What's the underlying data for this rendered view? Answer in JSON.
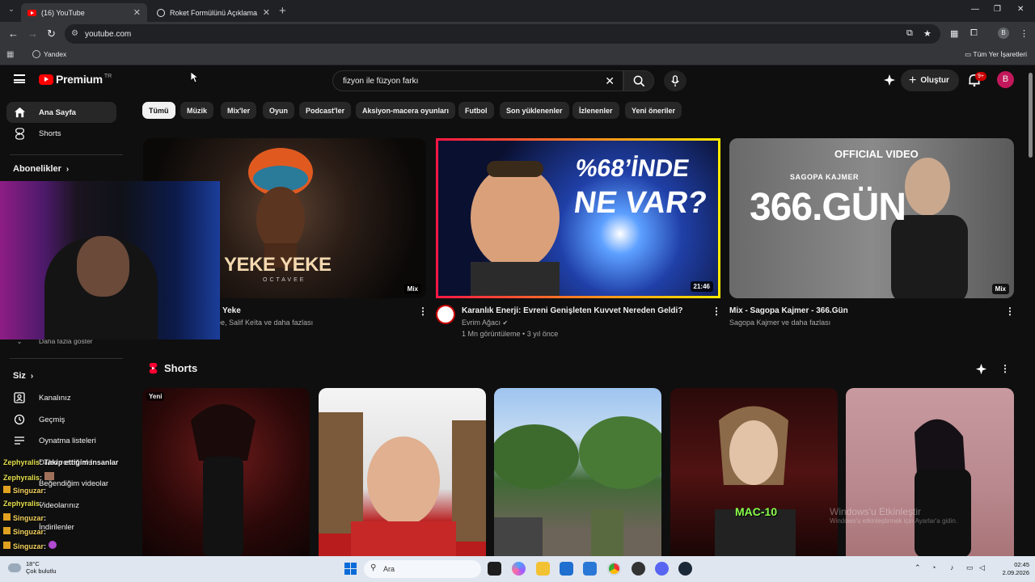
{
  "browser": {
    "tabs": [
      {
        "label": "(16) YouTube"
      },
      {
        "label": "Roket Formülünü Açıklama"
      }
    ],
    "url": "youtube.com",
    "bookmarks": {
      "yandex": "Yandex",
      "all": "Tüm Yer İşaretleri"
    },
    "profile_initial": "B"
  },
  "header": {
    "logo_text": "Premium",
    "logo_country": "TR",
    "search_value": "fizyon ile füzyon farkı",
    "create_label": "Oluştur",
    "notification_count": "9+",
    "avatar_initial": "B"
  },
  "sidebar": {
    "items": [
      {
        "label": "Ana Sayfa"
      },
      {
        "label": "Shorts"
      }
    ],
    "subscriptions_head": "Abonelikler",
    "show_more": "Daha fazla göster",
    "you_head": "Siz",
    "you_items": [
      {
        "label": "Kanalınız"
      },
      {
        "label": "Geçmiş"
      },
      {
        "label": "Oynatma listeleri"
      },
      {
        "label": "Daha sonra izle"
      },
      {
        "label": "Beğendiğim videolar"
      },
      {
        "label": "Videolarınız"
      },
      {
        "label": "İndirilenler"
      }
    ]
  },
  "chips": [
    "Tümü",
    "Müzik",
    "Mix'ler",
    "Oyun",
    "Podcast'ler",
    "Aksiyon-macera oyunları",
    "Futbol",
    "Son yüklenenler",
    "İzlenenler",
    "Yeni öneriler"
  ],
  "videos": [
    {
      "title": "Yeke",
      "meta1": "ee, Salif Keïta ve daha fazlası",
      "meta2": "",
      "badge": "Mix",
      "thumb_text": "YEKE YEKE",
      "thumb_sub": "OCTAVEE"
    },
    {
      "title": "Karanlık Enerji: Evreni Genişleten Kuvvet Nereden Geldi?",
      "meta1": "Evrim Ağacı",
      "meta2": "1 Mn görüntüleme • 3 yıl önce",
      "badge": "21:46",
      "thumb_text1": "%68’İNDE",
      "thumb_text2": "NE VAR?"
    },
    {
      "title": "Mix - Sagopa Kajmer - 366.Gün",
      "meta1": "Sagopa Kajmer ve daha fazlası",
      "meta2": "",
      "badge": "Mix",
      "thumb_top": "OFFICIAL VIDEO",
      "thumb_artist": "SAGOPA KAJMER",
      "thumb_big": "366.GÜN"
    }
  ],
  "shorts": {
    "heading": "Shorts",
    "new_badge": "Yeni",
    "short4_text": "MAC-10"
  },
  "chat": [
    {
      "user": "Zephyralis",
      "msg": ": Takip ettiğim insanlar"
    },
    {
      "user": "Zephyralis",
      "msg": ":"
    },
    {
      "user": "Singuzar",
      "msg": ":"
    },
    {
      "user": "Zephyralis",
      "msg": ":"
    },
    {
      "user": "Singuzar",
      "msg": ":"
    },
    {
      "user": "Singuzar",
      "msg": ":"
    },
    {
      "user": "Singuzar",
      "msg": ":"
    }
  ],
  "watermark": {
    "line1": "Windows'u Etkinleştir",
    "line2": "Windows'u etkinleştirmek için Ayarlar'a gidin."
  },
  "taskbar": {
    "weather_temp": "18°C",
    "weather_desc": "Çok bulutlu",
    "search_placeholder": "Ara",
    "time": "02:45",
    "date": "2.09.2026"
  },
  "colors": {
    "accent": "#ff0000",
    "background": "#0f0f0f",
    "chip_selected": "#f1f1f1"
  }
}
